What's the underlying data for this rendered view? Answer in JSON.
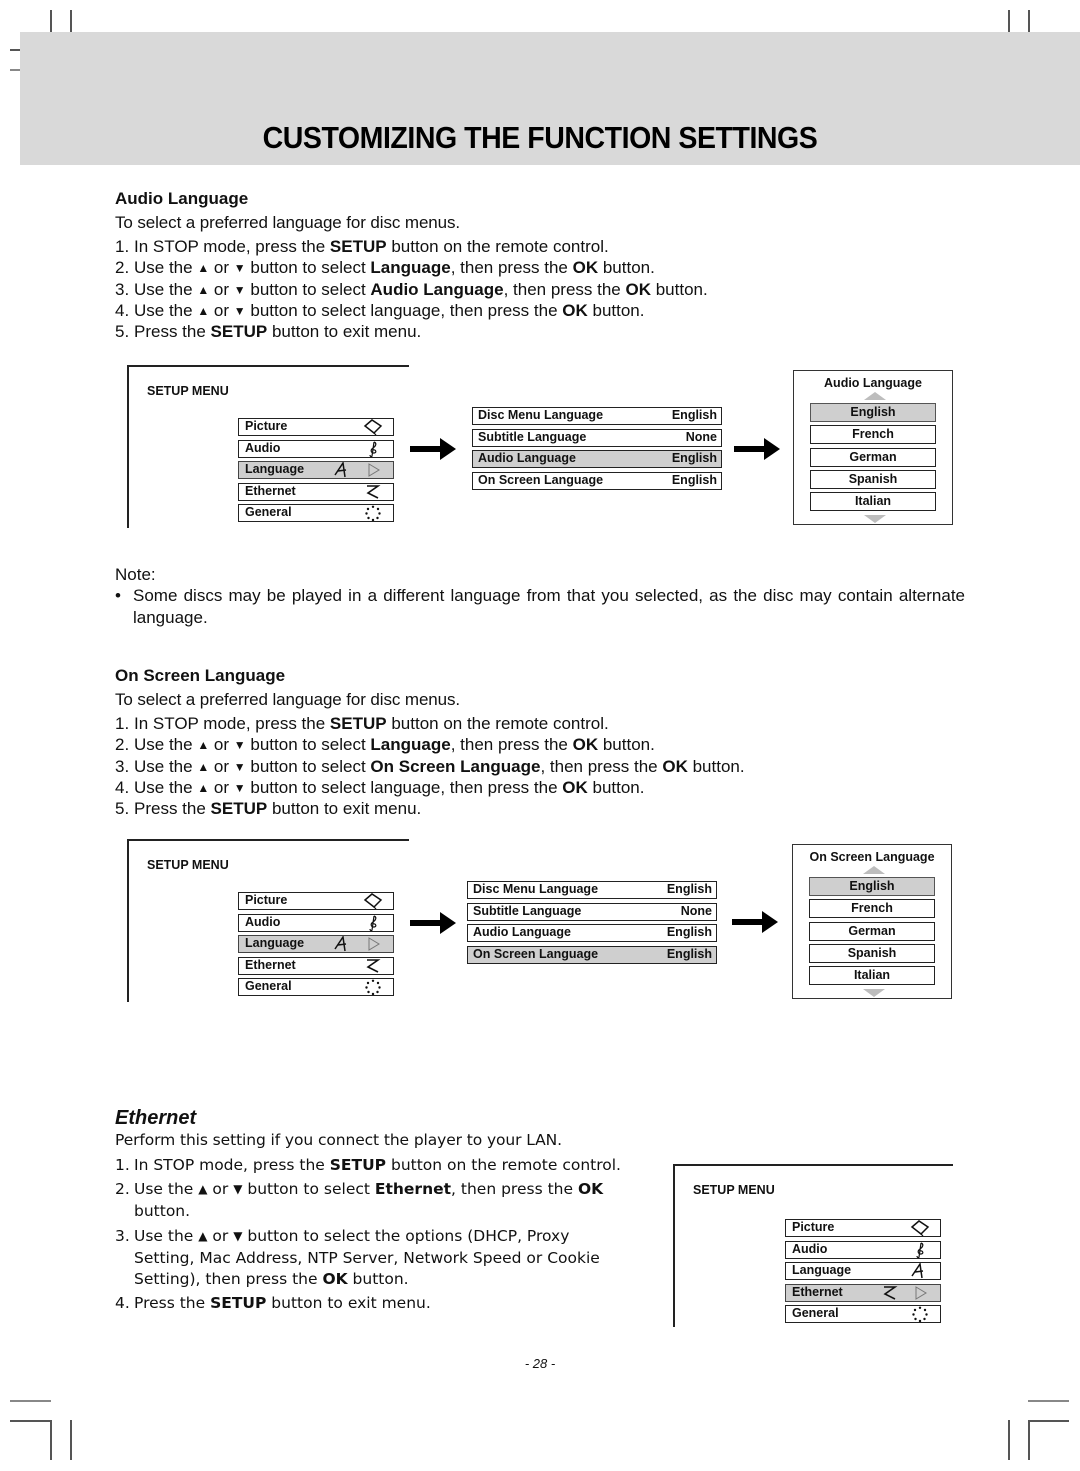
{
  "page": {
    "title": "CUSTOMIZING THE FUNCTION SETTINGS",
    "page_number": "- 28 -"
  },
  "audio_language": {
    "heading": "Audio Language",
    "intro": "To select a preferred language for disc menus.",
    "steps": [
      {
        "num": "1.",
        "parts": [
          "In STOP mode, press the ",
          "SETUP",
          " button on the remote control."
        ]
      },
      {
        "num": "2.",
        "parts": [
          "Use the ",
          "▲",
          " or ",
          "▼",
          " button to select ",
          "Language",
          ", then press the ",
          "OK",
          " button."
        ]
      },
      {
        "num": "3.",
        "parts": [
          "Use the ",
          "▲",
          " or ",
          "▼",
          " button to select ",
          "Audio Language",
          ", then press the ",
          "OK",
          " button."
        ]
      },
      {
        "num": "4.",
        "parts": [
          "Use the ",
          "▲",
          " or ",
          "▼",
          " button to select language, then press the ",
          "OK",
          " button."
        ]
      },
      {
        "num": "5.",
        "parts": [
          "Press the ",
          "SETUP",
          " button to exit menu."
        ]
      }
    ],
    "diagram": {
      "setup_title": "SETUP MENU",
      "menu_items": [
        {
          "label": "Picture",
          "icon": "picture-icon"
        },
        {
          "label": "Audio",
          "icon": "audio-icon"
        },
        {
          "label": "Language",
          "icon": "language-icon",
          "selected": true
        },
        {
          "label": "Ethernet",
          "icon": "ethernet-icon"
        },
        {
          "label": "General",
          "icon": "general-icon"
        }
      ],
      "submenu": [
        {
          "label": "Disc Menu Language",
          "value": "English"
        },
        {
          "label": "Subtitle Language",
          "value": "None"
        },
        {
          "label": "Audio Language",
          "value": "English",
          "selected": true
        },
        {
          "label": "On Screen Language",
          "value": "English"
        }
      ],
      "options_title": "Audio Language",
      "options": [
        "English",
        "French",
        "German",
        "Spanish",
        "Italian"
      ],
      "options_selected": "English"
    }
  },
  "note": {
    "label": "Note:",
    "bullet": "•",
    "text": "Some discs may be played in a different language from that you selected, as the disc may contain alternate language."
  },
  "on_screen_language": {
    "heading": "On Screen Language",
    "intro": "To select a preferred language for disc menus.",
    "steps": [
      {
        "num": "1.",
        "parts": [
          "In STOP mode, press the ",
          "SETUP",
          " button on the remote control."
        ]
      },
      {
        "num": "2.",
        "parts": [
          "Use the ",
          "▲",
          " or ",
          "▼",
          " button to select ",
          "Language",
          ", then press the ",
          "OK",
          " button."
        ]
      },
      {
        "num": "3.",
        "parts": [
          "Use the ",
          "▲",
          " or ",
          "▼",
          " button to select ",
          "On Screen Language",
          ", then press the ",
          "OK",
          " button."
        ]
      },
      {
        "num": "4.",
        "parts": [
          "Use the ",
          "▲",
          " or ",
          "▼",
          " button to select language, then press the ",
          "OK",
          " button."
        ]
      },
      {
        "num": "5.",
        "parts": [
          "Press the ",
          "SETUP",
          " button to exit menu."
        ]
      }
    ],
    "diagram": {
      "setup_title": "SETUP MENU",
      "menu_items": [
        {
          "label": "Picture",
          "icon": "picture-icon"
        },
        {
          "label": "Audio",
          "icon": "audio-icon"
        },
        {
          "label": "Language",
          "icon": "language-icon",
          "selected": true
        },
        {
          "label": "Ethernet",
          "icon": "ethernet-icon"
        },
        {
          "label": "General",
          "icon": "general-icon"
        }
      ],
      "submenu": [
        {
          "label": "Disc Menu Language",
          "value": "English"
        },
        {
          "label": "Subtitle Language",
          "value": "None"
        },
        {
          "label": "Audio Language",
          "value": "English"
        },
        {
          "label": "On Screen Language",
          "value": "English",
          "selected": true
        }
      ],
      "options_title": "On Screen Language",
      "options": [
        "English",
        "French",
        "German",
        "Spanish",
        "Italian"
      ],
      "options_selected": "English"
    }
  },
  "ethernet": {
    "heading": "Ethernet",
    "intro": "Perform this setting if you connect the player to your LAN.",
    "steps": [
      {
        "num": "1.",
        "lines": [
          "In STOP mode, press the SETUP button on the remote control."
        ]
      },
      {
        "num": "2.",
        "lines": [
          "Use the ▲ or ▼ button to select Ethernet, then press the OK",
          "button."
        ]
      },
      {
        "num": "3.",
        "lines": [
          "Use the ▲ or ▼ button to select the options (DHCP, Proxy",
          "Setting, Mac Address, NTP Server, Network Speed or Cookie",
          "Setting), then press the OK button."
        ]
      },
      {
        "num": "4.",
        "lines": [
          "Press the SETUP button to exit menu."
        ]
      }
    ],
    "bold_terms": [
      "SETUP",
      "Ethernet",
      "OK"
    ],
    "diagram": {
      "setup_title": "SETUP MENU",
      "menu_items": [
        {
          "label": "Picture",
          "icon": "picture-icon"
        },
        {
          "label": "Audio",
          "icon": "audio-icon"
        },
        {
          "label": "Language",
          "icon": "language-icon"
        },
        {
          "label": "Ethernet",
          "icon": "ethernet-icon",
          "selected": true
        },
        {
          "label": "General",
          "icon": "general-icon"
        }
      ]
    }
  }
}
